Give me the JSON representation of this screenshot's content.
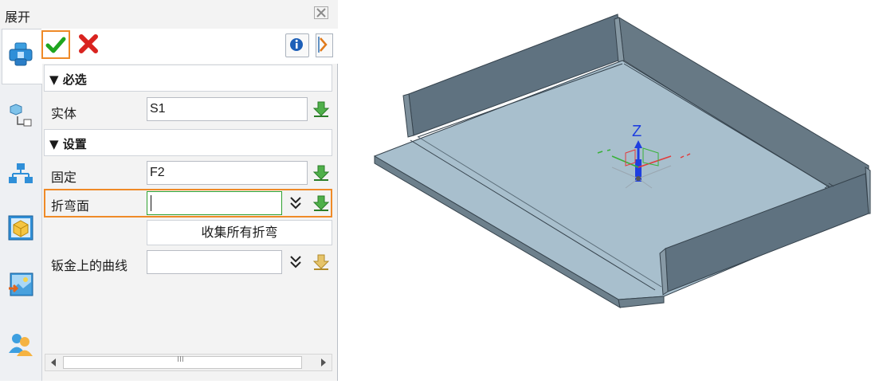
{
  "panel": {
    "title": "展开",
    "close_icon": "close-icon",
    "toolbar": {
      "ok_icon": "check-icon",
      "cancel_icon": "cross-icon",
      "info_icon": "info-icon",
      "more_icon": "expand-arrow-icon"
    },
    "leftbar": [
      "unfold-feature-icon",
      "assembly-tree-icon",
      "hierarchy-icon",
      "part-box-icon",
      "image-import-icon",
      "user-icon"
    ],
    "required_section": {
      "header": "必选",
      "solid_label": "实体",
      "solid_value": "S1"
    },
    "settings_section": {
      "header": "设置",
      "fixed_label": "固定",
      "fixed_value": "F2",
      "bend_face_label": "折弯面",
      "bend_face_value": "",
      "collect_button": "收集所有折弯",
      "curves_label": "钣金上的曲线",
      "curves_value": ""
    },
    "scrollbar_grip": "III"
  },
  "viewport": {
    "axis_label": "Z",
    "part_color": "#a4bccb",
    "wall_color": "#5d6e7c"
  },
  "colors": {
    "highlight": "#ef8a27",
    "ok_green": "#1fa51f",
    "cancel_red": "#d9231f",
    "pick_green": "#3ea43a"
  }
}
